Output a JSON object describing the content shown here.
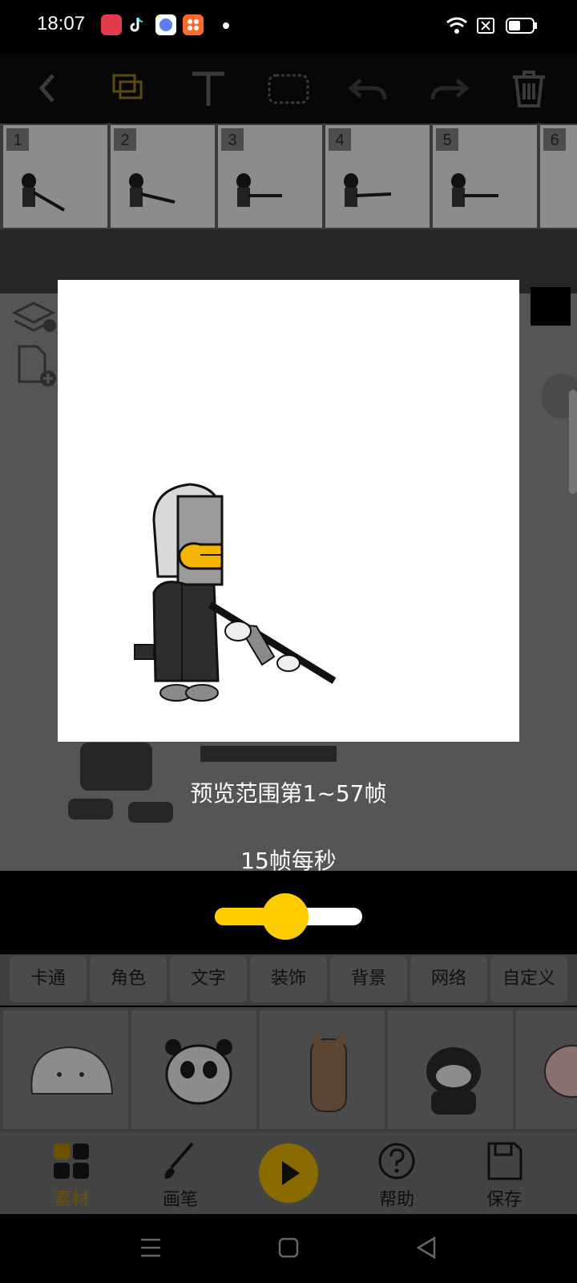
{
  "status_bar": {
    "time": "18:07",
    "notification_icons": [
      "screen-record-icon",
      "tiktok-icon",
      "app-icon",
      "grid-app-icon"
    ],
    "battery_level": 0.5
  },
  "toolbar": {
    "icons": [
      "back-icon",
      "layers-copy-icon",
      "text-tool-icon",
      "select-rect-icon",
      "undo-icon",
      "redo-icon",
      "delete-icon"
    ]
  },
  "frames": {
    "numbers": [
      "1",
      "2",
      "3",
      "4",
      "5",
      "6"
    ]
  },
  "preview": {
    "range_text": "预览范围第1~57帧",
    "fps_text": "15帧每秒",
    "fps_slider_fraction": 0.48
  },
  "categories": [
    "卡通",
    "角色",
    "文字",
    "装饰",
    "背景",
    "网络",
    "自定义"
  ],
  "stickers": [
    "blob-sticker",
    "panda-sticker",
    "bear-sticker",
    "raccoon-sticker",
    "pig-sticker"
  ],
  "bottom_nav": {
    "material_label": "素材",
    "brush_label": "画笔",
    "help_label": "帮助",
    "save_label": "保存"
  },
  "colors": {
    "accent": "#ffcc00",
    "dim_overlay": "#555555"
  }
}
